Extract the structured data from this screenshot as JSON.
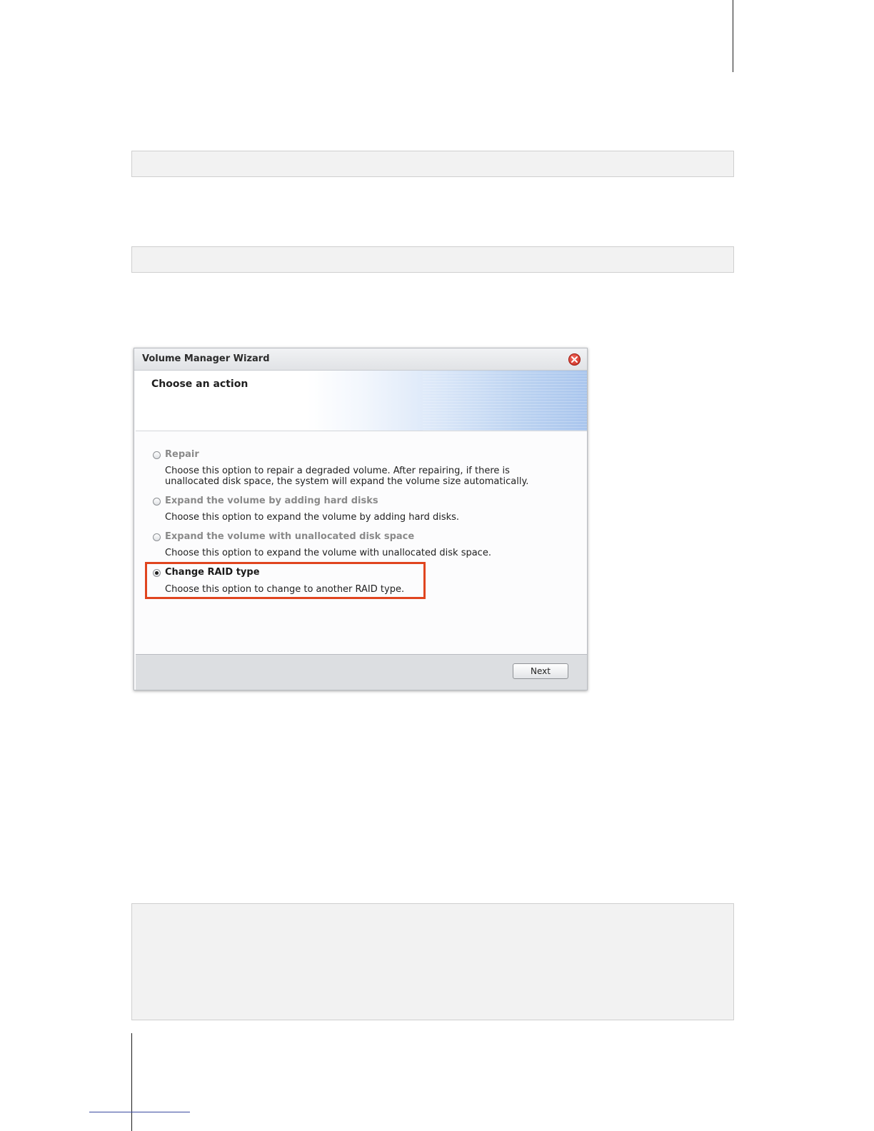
{
  "dialog": {
    "title": "Volume Manager Wizard",
    "heading": "Choose an action",
    "options": [
      {
        "label": "Repair",
        "description_lines": [
          "Choose this option to repair a degraded volume. After repairing, if there is",
          "unallocated disk space, the system will expand the volume size automatically."
        ],
        "selected": false,
        "enabled": false
      },
      {
        "label": "Expand the volume by adding hard disks",
        "description_lines": [
          "Choose this option to expand the volume by adding hard disks."
        ],
        "selected": false,
        "enabled": false
      },
      {
        "label": "Expand the volume with unallocated disk space",
        "description_lines": [
          "Choose this option to expand the volume with unallocated disk space."
        ],
        "selected": false,
        "enabled": false
      },
      {
        "label": "Change RAID type",
        "description_lines": [
          "Choose this option to change to another RAID type."
        ],
        "selected": true,
        "enabled": true
      }
    ],
    "next_label": "Next",
    "highlight_color": "#e0451f"
  }
}
